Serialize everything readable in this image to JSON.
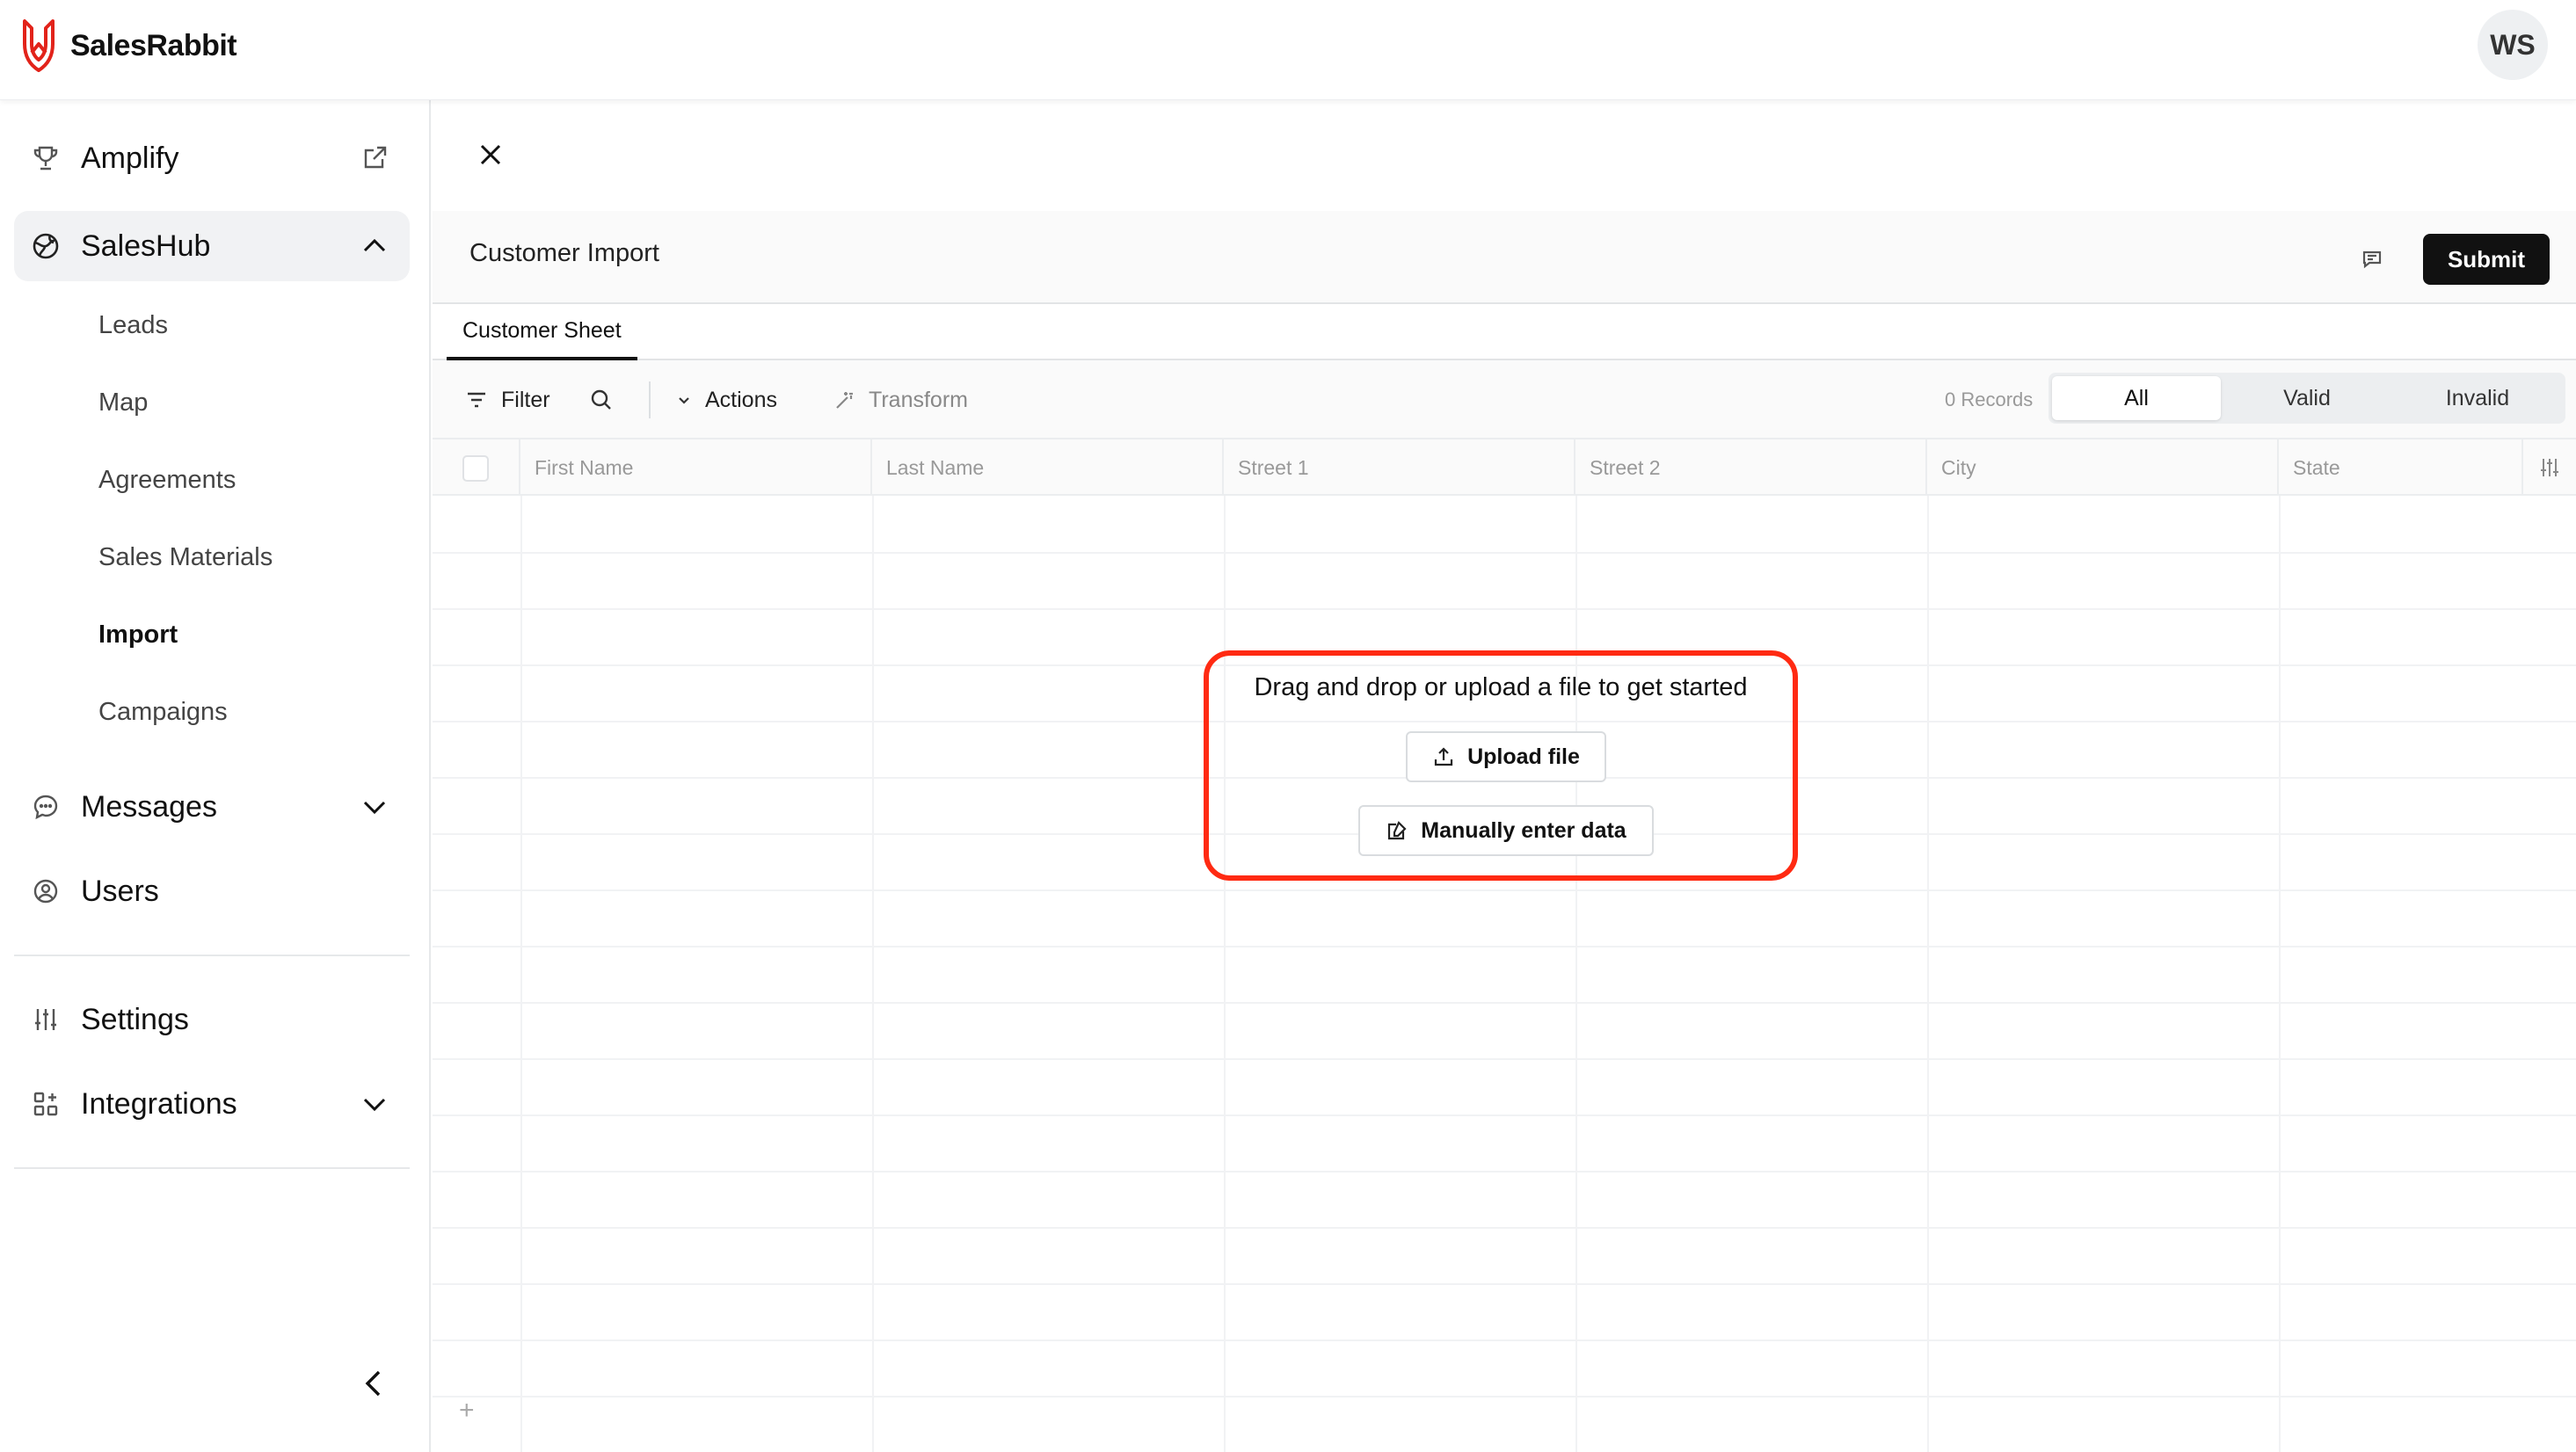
{
  "app": {
    "name": "SalesRabbit",
    "brand_color": "#e2231a"
  },
  "user": {
    "initials": "WS"
  },
  "sidebar": {
    "items": [
      {
        "label": "Amplify",
        "icon": "trophy-icon",
        "trail": "external-link-icon"
      },
      {
        "label": "SalesHub",
        "icon": "globe-icon",
        "trail": "chevron-up-icon",
        "expanded": true
      },
      {
        "label": "Messages",
        "icon": "chat-bubble-icon",
        "trail": "chevron-down-icon"
      },
      {
        "label": "Users",
        "icon": "user-circle-icon"
      },
      {
        "label": "Settings",
        "icon": "sliders-icon"
      },
      {
        "label": "Integrations",
        "icon": "grid-plus-icon",
        "trail": "chevron-down-icon"
      }
    ],
    "saleshub_children": [
      "Leads",
      "Map",
      "Agreements",
      "Sales Materials",
      "Import",
      "Campaigns"
    ],
    "current_child": "Import"
  },
  "main": {
    "title": "Customer Import",
    "submit_label": "Submit",
    "tab": "Customer Sheet",
    "toolbar": {
      "filter": "Filter",
      "actions": "Actions",
      "transform": "Transform",
      "records": "0 Records",
      "segments": [
        "All",
        "Valid",
        "Invalid"
      ],
      "selected_segment": "All"
    },
    "columns": [
      "First Name",
      "Last Name",
      "Street 1",
      "Street 2",
      "City",
      "State"
    ],
    "empty_state": {
      "message": "Drag and drop or upload a file to get started",
      "upload_label": "Upload file",
      "manual_label": "Manually enter data"
    },
    "add_row": "+"
  },
  "highlight_color": "#ff2a12"
}
